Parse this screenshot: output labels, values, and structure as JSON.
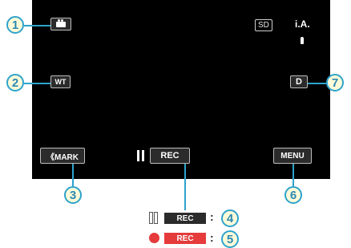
{
  "screen": {
    "mode_button": {
      "icon": "movie-camera-icon"
    },
    "sd_indicator": "SD",
    "ia_indicator": "i.A.",
    "ia_sub_icon": "person-icon",
    "wt_button": "WT",
    "d_button": "D",
    "mark_button": "《MARK",
    "pause_rec_button": "REC",
    "menu_button": "MENU"
  },
  "callouts": [
    "1",
    "2",
    "3",
    "4",
    "5",
    "6",
    "7"
  ],
  "legend": {
    "paused": {
      "label": "REC",
      "separator": ":"
    },
    "recording": {
      "label": "REC",
      "separator": ":"
    }
  },
  "colors": {
    "screen_bg": "#000000",
    "callout_border": "#2ea3cc",
    "callout_fill": "#fffbd9",
    "callout_text": "#2c89b1",
    "rec_paused_bg": "#2b2b2b",
    "rec_active_bg": "#e53b3b"
  }
}
